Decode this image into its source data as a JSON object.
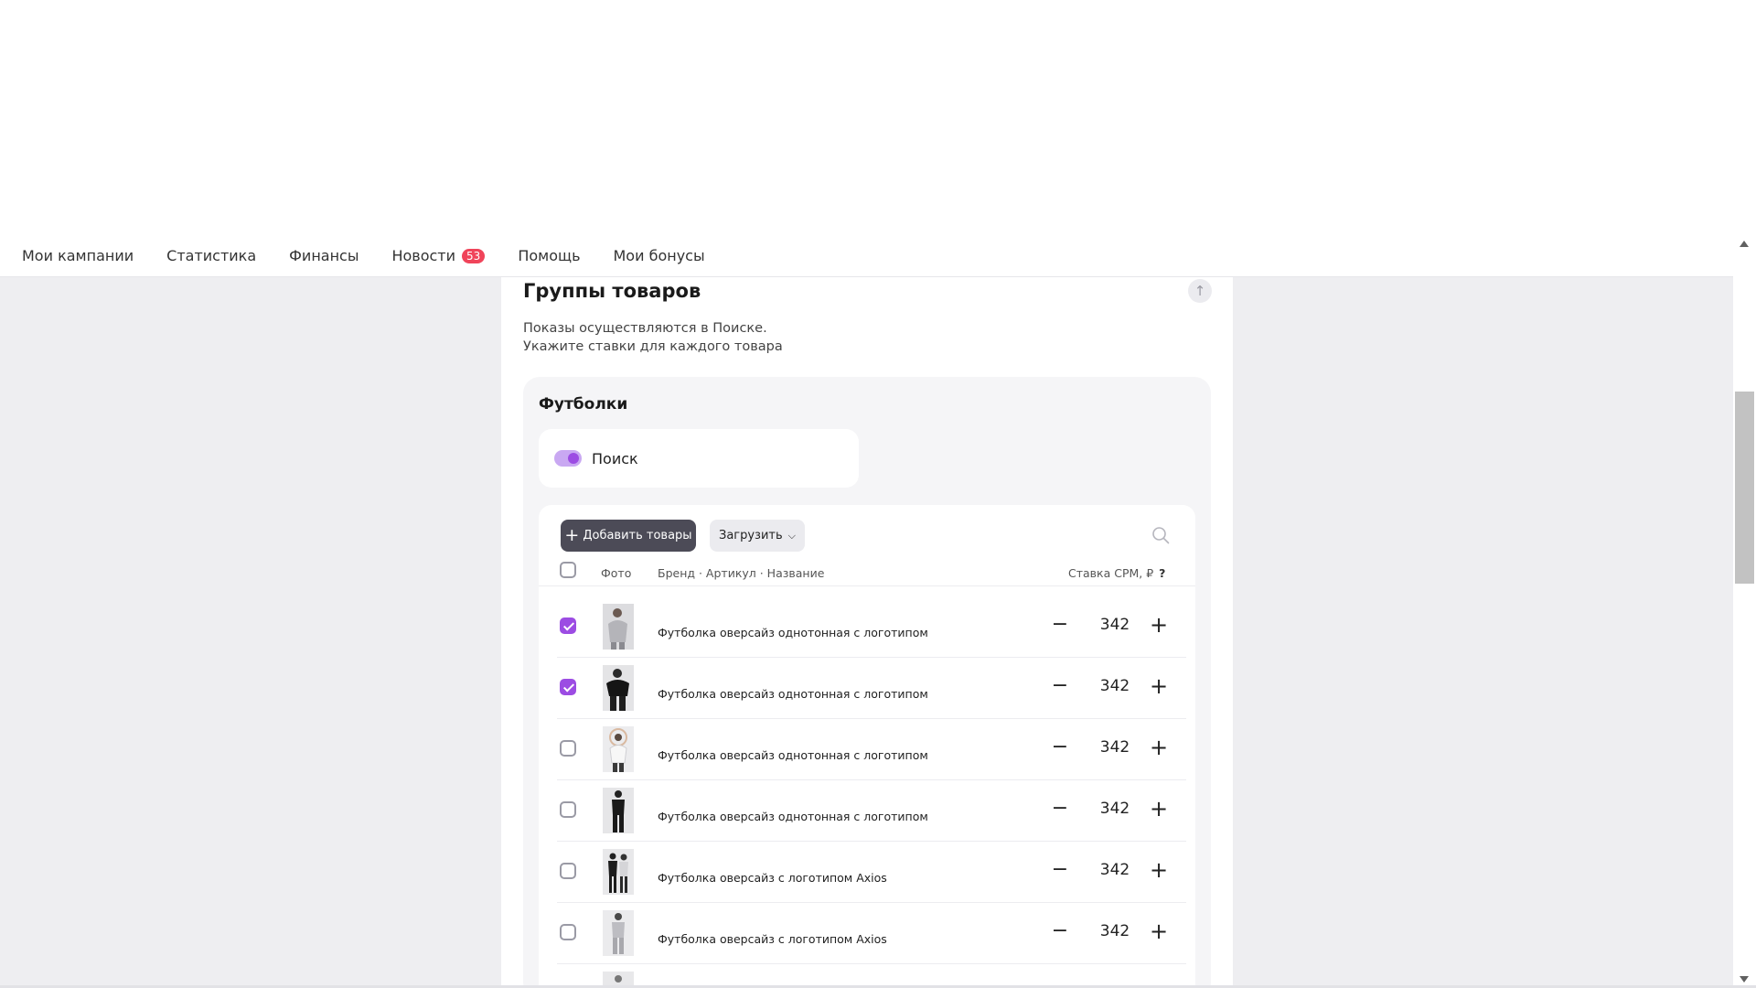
{
  "nav": {
    "items": [
      {
        "label": "Мои кампании"
      },
      {
        "label": "Статистика"
      },
      {
        "label": "Финансы"
      },
      {
        "label": "Новости",
        "badge": "53"
      },
      {
        "label": "Помощь"
      },
      {
        "label": "Мои бонусы"
      }
    ]
  },
  "section": {
    "title": "Группы товаров",
    "description_line1": "Показы осуществляются в Поиске.",
    "description_line2": "Укажите ставки для каждого товара",
    "scroll_up_icon": "arrow-up-icon"
  },
  "group": {
    "title": "Футболки",
    "placement_label": "Поиск",
    "placement_enabled": true,
    "add_button": "Добавить товары",
    "load_button": "Загрузить",
    "search_icon": "search-icon",
    "columns": {
      "photo": "Фото",
      "name": "Бренд · Артикул · Название",
      "rate": "Ставка CPM, ₽",
      "help": "?"
    },
    "products": [
      {
        "name": "Футболка оверсайз однотонная с логотипом",
        "rate": "342",
        "checked": true,
        "photo": "grey-tshirt-photo"
      },
      {
        "name": "Футболка оверсайз однотонная с логотипом",
        "rate": "342",
        "checked": true,
        "photo": "black-tshirt-photo"
      },
      {
        "name": "Футболка оверсайз однотонная с логотипом",
        "rate": "342",
        "checked": false,
        "photo": "white-tshirt-photo"
      },
      {
        "name": "Футболка оверсайз однотонная с логотипом",
        "rate": "342",
        "checked": false,
        "photo": "black-outfit-photo"
      },
      {
        "name": "Футболка оверсайз с логотипом Axios",
        "rate": "342",
        "checked": false,
        "photo": "couple-photo"
      },
      {
        "name": "Футболка оверсайз с логотипом Axios",
        "rate": "342",
        "checked": false,
        "photo": "grey-outfit-photo"
      },
      {
        "name": "",
        "rate": "",
        "checked": false,
        "photo": "partial-photo"
      }
    ]
  },
  "colors": {
    "accent": "#9c4ce3",
    "dark_button": "#4c4b57",
    "badge": "#f0445a",
    "background": "#eeeef1"
  }
}
